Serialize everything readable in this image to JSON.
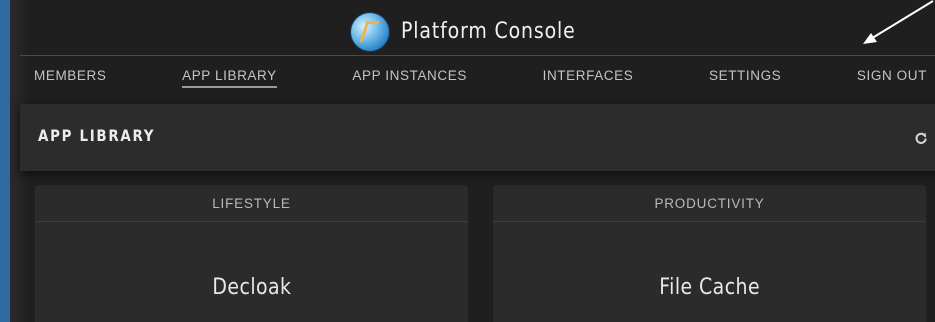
{
  "header": {
    "title": "Platform Console",
    "logo_icon": "globe-logo-icon"
  },
  "nav": {
    "items": [
      {
        "label": "MEMBERS",
        "active": false
      },
      {
        "label": "APP LIBRARY",
        "active": true
      },
      {
        "label": "APP INSTANCES",
        "active": false
      },
      {
        "label": "INTERFACES",
        "active": false
      },
      {
        "label": "SETTINGS",
        "active": false
      },
      {
        "label": "SIGN OUT",
        "active": false
      }
    ]
  },
  "section": {
    "title": "APP LIBRARY",
    "refresh_icon": "refresh-icon"
  },
  "cards": [
    {
      "category": "LIFESTYLE",
      "name": "Decloak"
    },
    {
      "category": "PRODUCTIVITY",
      "name": "File Cache"
    }
  ],
  "colors": {
    "outer_background": "#2f6aa3",
    "app_background": "#1f1f1f",
    "panel": "#2c2c2c",
    "card": "#2b2b2b",
    "arrow": "#ffffff"
  }
}
